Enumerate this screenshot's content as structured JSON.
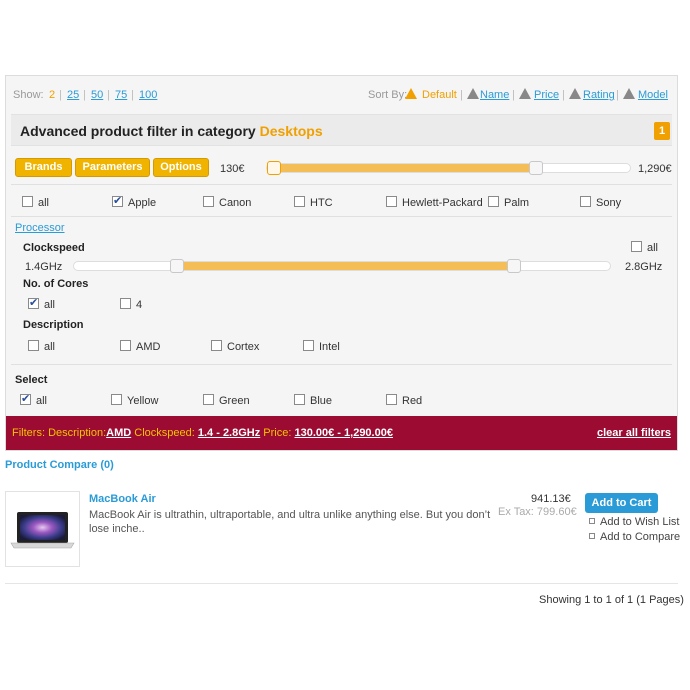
{
  "toolbar": {
    "show_label": "Show:",
    "show_options": [
      "2",
      "25",
      "50",
      "75",
      "100"
    ],
    "show_separator": "|",
    "sort_label": "Sort By:",
    "sort_options": [
      "Default",
      "Name",
      "Price",
      "Rating",
      "Model"
    ],
    "sort_separator": "|"
  },
  "header": {
    "title_prefix": "Advanced product filter in category",
    "category": "Desktops",
    "badge": "1"
  },
  "tabs": {
    "brands": "Brands",
    "parameters": "Parameters",
    "options": "Options"
  },
  "price_slider": {
    "min_label": "130€",
    "max_label": "1,290€",
    "low_fraction": 0.0,
    "high_fraction": 0.74
  },
  "brands": [
    {
      "label": "all",
      "checked": false
    },
    {
      "label": "Apple",
      "checked": true
    },
    {
      "label": "Canon",
      "checked": false
    },
    {
      "label": "HTC",
      "checked": false
    },
    {
      "label": "Hewlett-Packard",
      "checked": false
    },
    {
      "label": "Palm",
      "checked": false
    },
    {
      "label": "Sony",
      "checked": false
    }
  ],
  "processor": {
    "section_label": "Processor",
    "clockspeed": {
      "label": "Clockspeed",
      "all_label": "all",
      "all_checked": false,
      "min_label": "1.4GHz",
      "max_label": "2.8GHz",
      "low_fraction": 0.18,
      "high_fraction": 0.82
    },
    "cores": {
      "label": "No. of Cores",
      "items": [
        {
          "label": "all",
          "checked": true
        },
        {
          "label": "4",
          "checked": false
        }
      ]
    },
    "description": {
      "label": "Description",
      "items": [
        {
          "label": "all",
          "checked": false
        },
        {
          "label": "AMD",
          "checked": true
        },
        {
          "label": "Cortex",
          "checked": false
        },
        {
          "label": "Intel",
          "checked": false
        }
      ]
    }
  },
  "select": {
    "label": "Select",
    "items": [
      {
        "label": "all",
        "checked": true
      },
      {
        "label": "Yellow",
        "checked": false
      },
      {
        "label": "Green",
        "checked": false
      },
      {
        "label": "Blue",
        "checked": false
      },
      {
        "label": "Red",
        "checked": false
      }
    ]
  },
  "filters_bar": {
    "prefix": "Filters:",
    "description_label": "Description:",
    "description_value": "AMD",
    "clockspeed_label": "Clockspeed:",
    "clockspeed_value": "1.4 - 2.8GHz",
    "price_label": "Price:",
    "price_value": "130.00€ - 1,290.00€",
    "clear_all": "clear all filters"
  },
  "product_compare": "Product Compare (0)",
  "product": {
    "name": "MacBook Air",
    "description": "MacBook Air is ultrathin, ultraportable, and ultra unlike anything else. But you don’t lose inche..",
    "price": "941.13€",
    "ex_tax": "Ex Tax: 799.60€",
    "add_to_cart": "Add to Cart",
    "add_to_wishlist": "Add to Wish List",
    "add_to_compare": "Add to Compare"
  },
  "pagination": "Showing 1 to 1 of 1 (1 Pages)",
  "colors": {
    "accent": "#f0a000",
    "link": "#2a9bd6",
    "filter_bar": "#9b0b32",
    "slider_fill": "#f5bd55"
  }
}
